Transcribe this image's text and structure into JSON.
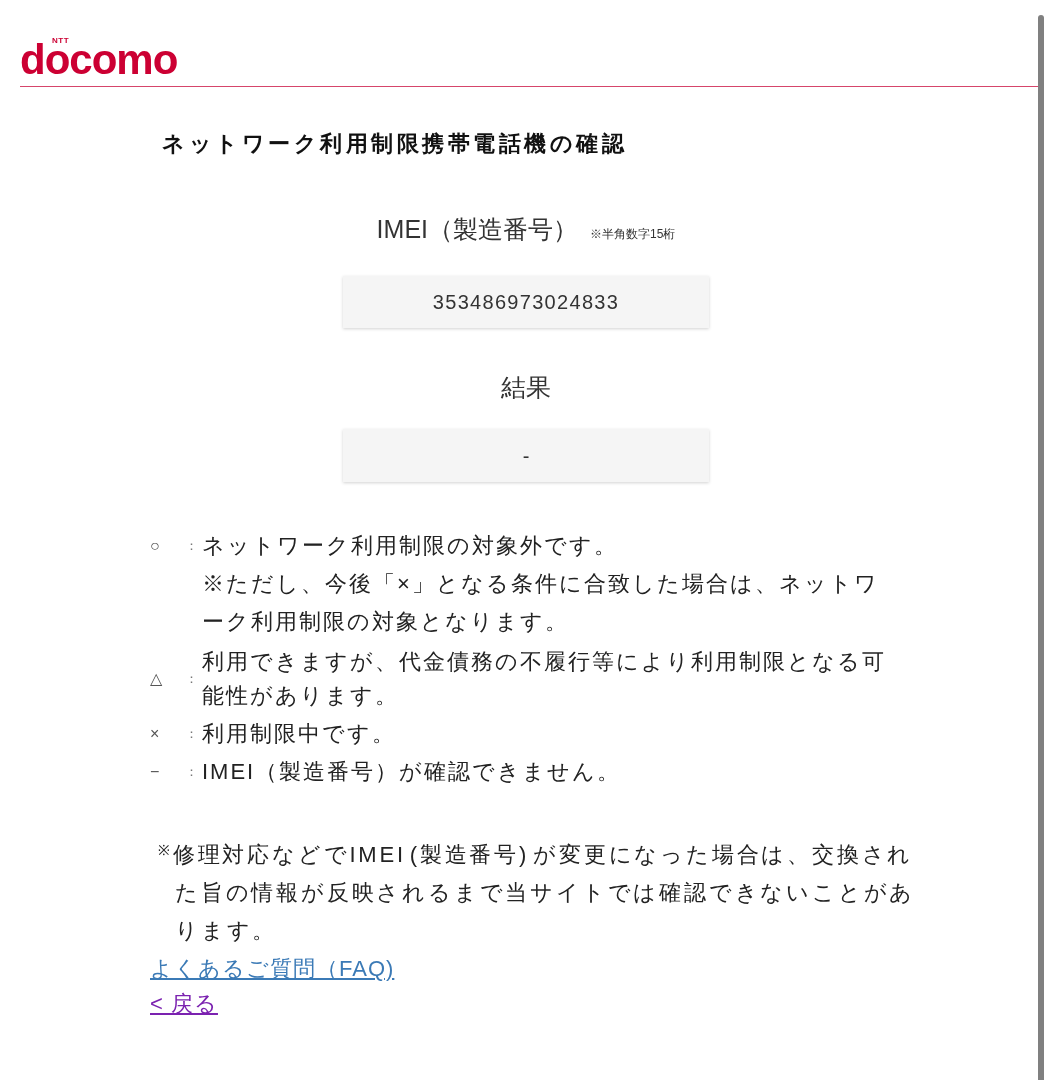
{
  "header": {
    "logo": {
      "company": "NTT",
      "brand": "docomo"
    }
  },
  "title": "ネットワーク利用制限携帯電話機の確認",
  "imei": {
    "label": "IMEI（製造番号）",
    "hint": "※半角数字15桁",
    "value": "353486973024833"
  },
  "result": {
    "label": "結果",
    "value": "-"
  },
  "legend": [
    {
      "symbol": "○",
      "separator": "：",
      "text": "ネットワーク利用制限の対象外です。",
      "note": "※ただし、今後「×」となる条件に合致した場合は、ネットワーク利用制限の対象となります。"
    },
    {
      "symbol": "△",
      "separator": "：",
      "text": "利用できますが、代金債務の不履行等により利用制限となる可能性があります。"
    },
    {
      "symbol": "×",
      "separator": "：",
      "text": "利用制限中です。"
    },
    {
      "symbol": "−",
      "separator": "：",
      "text": "IMEI（製造番号）が確認できません。"
    }
  ],
  "footnote": "$^{※}$修理対応などでIMEI (製造番号) が変更になった場合は、交換された旨の情報が反映されるまで当サイトでは確認できないことがあります。",
  "links": [
    {
      "text": "よくあるご質問（FAQ)",
      "visited": false
    },
    {
      "text": "< 戻る",
      "visited": true
    }
  ]
}
